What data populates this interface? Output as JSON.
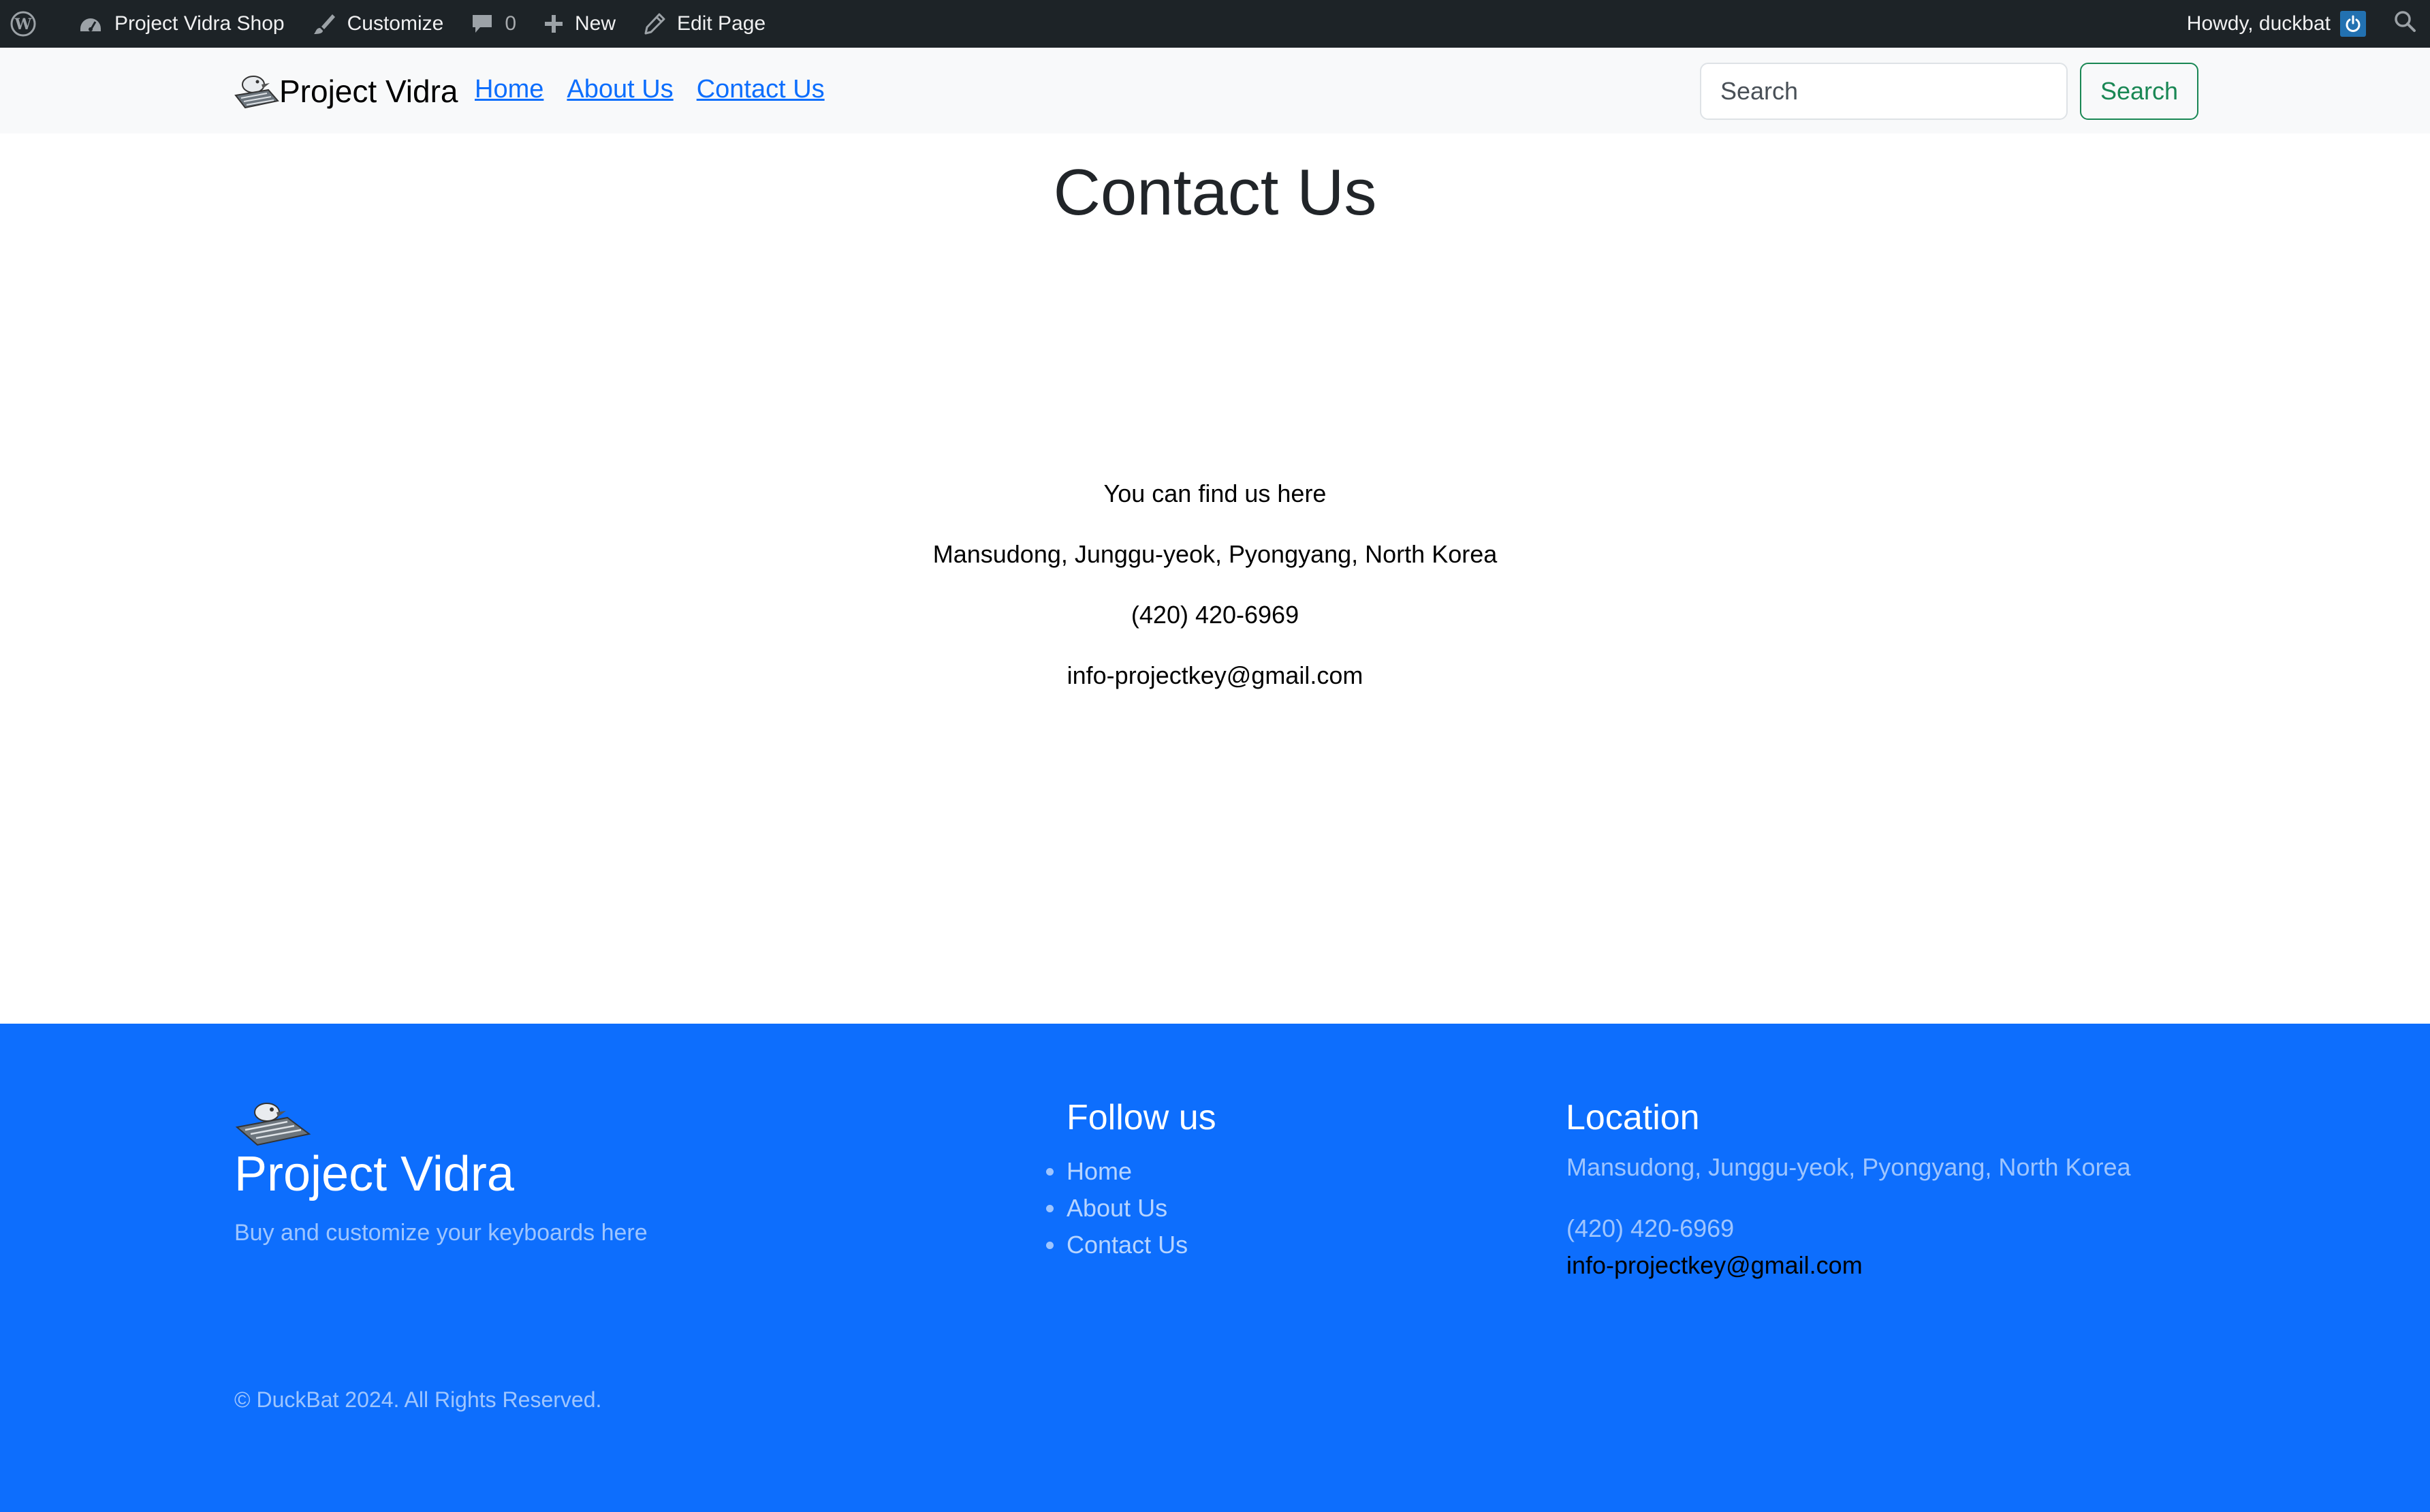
{
  "admin_bar": {
    "site_name": "Project Vidra Shop",
    "customize": "Customize",
    "comments_count": "0",
    "new": "New",
    "edit_page": "Edit Page",
    "greeting": "Howdy, duckbat"
  },
  "navbar": {
    "brand": "Project Vidra",
    "links": [
      "Home",
      "About Us",
      "Contact Us"
    ],
    "search_placeholder": "Search",
    "search_button": "Search"
  },
  "main": {
    "title": "Contact Us",
    "lines": [
      "You can find us here",
      "Mansudong, Junggu-yeok, Pyongyang, North Korea",
      "(420) 420-6969",
      "info-projectkey@gmail.com"
    ]
  },
  "footer": {
    "brand": "Project Vidra",
    "tagline": "Buy and customize your keyboards here",
    "follow_heading": "Follow us",
    "follow_links": [
      "Home",
      "About Us",
      "Contact Us"
    ],
    "location_heading": "Location",
    "address": "Mansudong, Junggu-yeok, Pyongyang, North Korea",
    "phone": "(420) 420-6969",
    "email": "info-projectkey@gmail.com",
    "copyright": "© DuckBat 2024. All Rights Reserved."
  },
  "colors": {
    "admin_bar_bg": "#1d2327",
    "navbar_bg": "#f8f9fa",
    "link": "#0d6efd",
    "search_button": "#198754",
    "footer_bg": "#0d6efd"
  }
}
